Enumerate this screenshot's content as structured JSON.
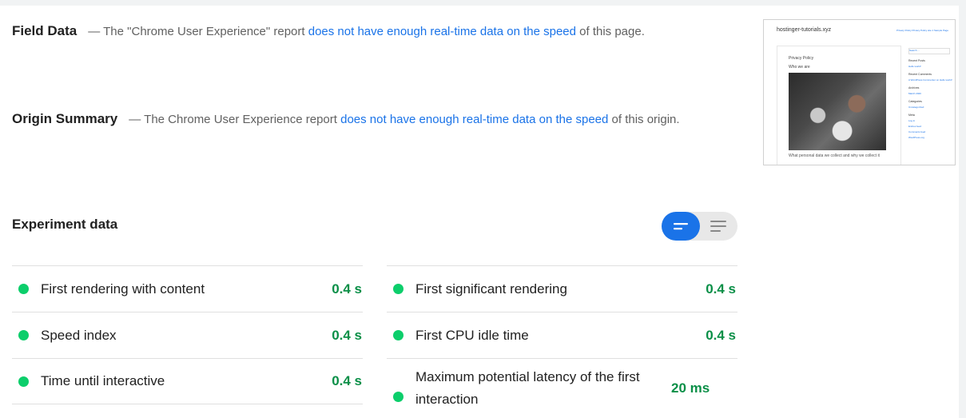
{
  "field_data": {
    "title": "Field Data",
    "dash": "—",
    "text_before": " The \"Chrome User Experience\" report ",
    "link": "does not have enough real-time data on the speed",
    "text_after": " of this page."
  },
  "origin_summary": {
    "title": "Origin Summary",
    "dash": "—",
    "text_before": " The Chrome User Experience report ",
    "link": "does not have enough real-time data on the speed",
    "text_after": " of this origin."
  },
  "thumbnail": {
    "site_title": "hostinger-tutorials.xyz",
    "nav": "Privacy Policy    Privacy Policy site 1    Sample Page",
    "heading": "Privacy Policy",
    "subheading": "Who we are",
    "caption": "What personal data we collect and why we collect it",
    "sidebar": {
      "search": "Search …",
      "recent_posts": "Recent Posts",
      "recent_post_item": "Hello world!",
      "recent_comments": "Recent Comments",
      "recent_comment_item": "A WordPress Commenter on Hello world!",
      "archives": "Archives",
      "archive_item": "March 2020",
      "categories": "Categories",
      "category_item": "Uncategorized",
      "meta": "Meta",
      "meta_items": [
        "Log in",
        "Entries feed",
        "Comments feed",
        "WordPress.org"
      ]
    }
  },
  "experiment": {
    "title": "Experiment data",
    "metrics_left": [
      {
        "label": "First rendering with content",
        "value": "0.4 s"
      },
      {
        "label": "Speed index",
        "value": "0.4 s"
      },
      {
        "label": "Time until interactive",
        "value": "0.4 s"
      }
    ],
    "metrics_right": [
      {
        "label": "First significant rendering",
        "value": "0.4 s"
      },
      {
        "label": "First CPU idle time",
        "value": "0.4 s"
      },
      {
        "label": "Maximum potential latency of the first interaction",
        "value": "20 ms"
      }
    ]
  },
  "colors": {
    "link": "#1a73e8",
    "pass": "#0cce6b",
    "pass_text": "#0a8f47",
    "toggle_active": "#1a73e8"
  }
}
